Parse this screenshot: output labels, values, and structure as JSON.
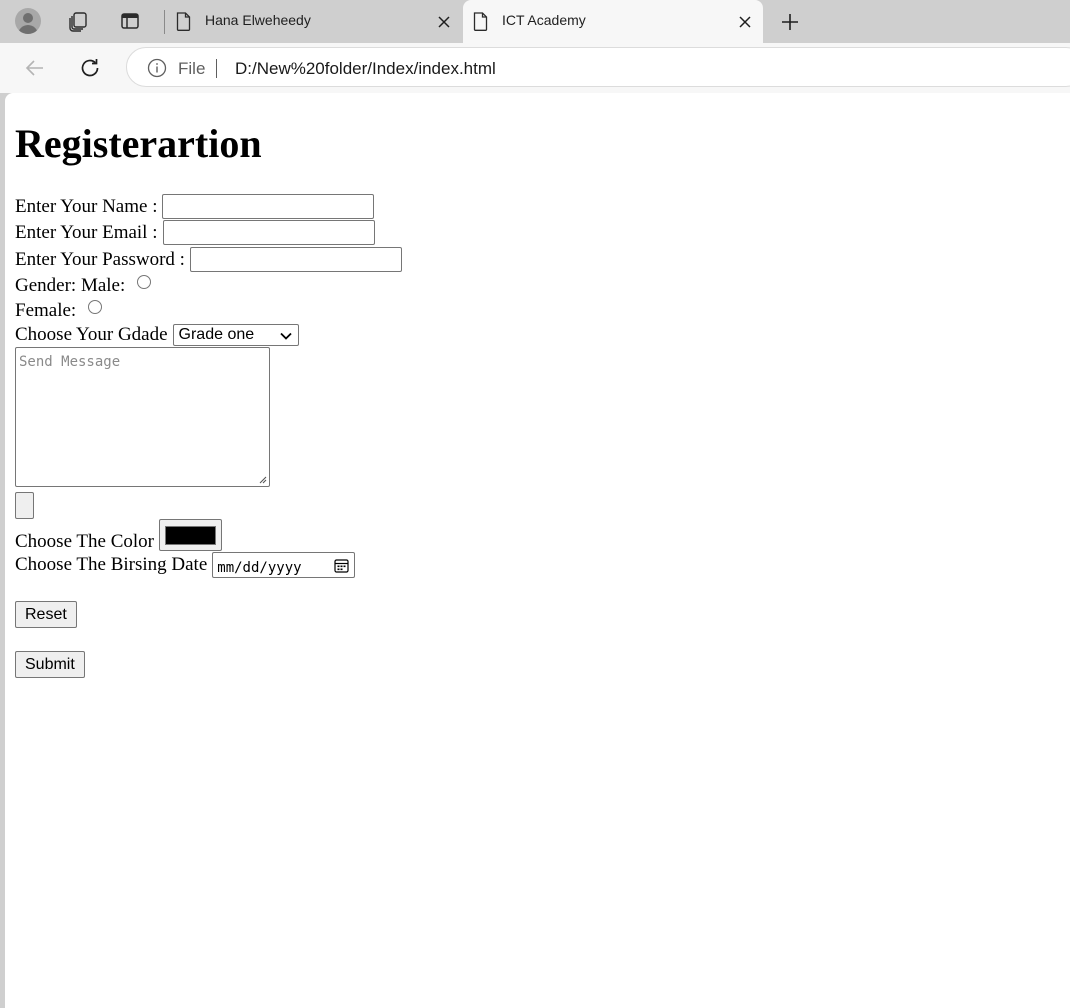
{
  "browser": {
    "tabs": [
      {
        "title": "Hana Elweheedy",
        "active": false
      },
      {
        "title": "ICT Academy",
        "active": true
      }
    ],
    "address": {
      "scheme_label": "File",
      "url": "D:/New%20folder/Index/index.html"
    }
  },
  "page": {
    "title": "Registerartion",
    "form": {
      "name_label": "Enter Your Name :",
      "email_label": "Enter Your Email :",
      "password_label": "Enter Your Password :",
      "gender_male_label": "Gender: Male:",
      "gender_female_label": "Female:",
      "grade_label": "Choose Your Gdade",
      "grade_selected": "Grade one",
      "message_placeholder": "Send Message",
      "color_label": "Choose The Color",
      "color_value": "#000000",
      "birth_label": "Choose The Birsing Date",
      "date_placeholder": "mm/dd/yyyy",
      "reset_label": "Reset",
      "submit_label": "Submit"
    }
  },
  "icons": [
    "profile-icon",
    "collections-icon",
    "tab-actions-icon",
    "document-icon",
    "close-icon",
    "plus-icon",
    "back-arrow-icon",
    "reload-icon",
    "info-icon",
    "chevron-down-icon",
    "calendar-icon",
    "resize-grip-icon"
  ]
}
